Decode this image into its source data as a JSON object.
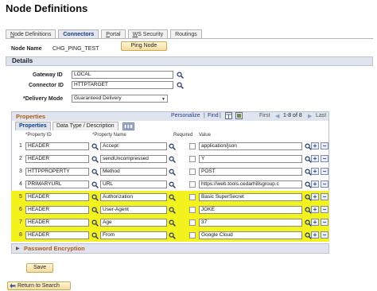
{
  "page": {
    "title": "Node Definitions"
  },
  "tabs": [
    {
      "label": "Node Definitions",
      "key": "N"
    },
    {
      "label": "Connectors",
      "key": "C"
    },
    {
      "label": "Portal",
      "key": "P"
    },
    {
      "label": "WS Security",
      "key": "W"
    },
    {
      "label": "Routings",
      "key": "R"
    }
  ],
  "node": {
    "label": "Node Name",
    "value": "CHG_PING_TEST",
    "ping_button": "Ping Node"
  },
  "details": {
    "title": "Details",
    "gateway": {
      "label": "Gateway ID",
      "value": "LOCAL"
    },
    "connector": {
      "label": "Connector ID",
      "value": "HTTPTARGET"
    },
    "delivery": {
      "label": "*Delivery Mode",
      "value": "Guaranteed Delivery"
    }
  },
  "properties": {
    "title": "Properties",
    "personalize": "Personalize",
    "find": "Find",
    "first": "First",
    "range": "1-8 of 8",
    "last": "Last",
    "subtabs": [
      "Properties",
      "Data Type / Description"
    ],
    "columns": {
      "id": "*Property ID",
      "name": "*Property Name",
      "required": "Required",
      "value": "Value"
    },
    "rows": [
      {
        "num": "1",
        "id": "HEADER",
        "name": "Accept",
        "value": "application/json",
        "highlight": false
      },
      {
        "num": "2",
        "id": "HEADER",
        "name": "sendUncompressed",
        "value": "Y",
        "highlight": false
      },
      {
        "num": "3",
        "id": "HTTPPROPERTY",
        "name": "Method",
        "value": "POST",
        "highlight": false
      },
      {
        "num": "4",
        "id": "PRIMARYURL",
        "name": "URL",
        "value": "https://web.tools.cedarhillsgroup.c",
        "highlight": false
      },
      {
        "num": "5",
        "id": "HEADER",
        "name": "Authorization",
        "value": "Basic SuperSecret",
        "highlight": true
      },
      {
        "num": "6",
        "id": "HEADER",
        "name": "User-Agent",
        "value": "JOKE",
        "highlight": true
      },
      {
        "num": "7",
        "id": "HEADER",
        "name": "Age",
        "value": "37",
        "highlight": true
      },
      {
        "num": "8",
        "id": "HEADER",
        "name": "From",
        "value": "Google Cloud",
        "highlight": true
      }
    ]
  },
  "password_section": {
    "label": "Password Encryption"
  },
  "buttons": {
    "save": "Save",
    "return": "Return to Search"
  },
  "colors": {
    "highlight": "#f4f21c",
    "section_bg": "#dfe4ee",
    "grid_title": "#b45a11",
    "link": "#1f3f8f"
  }
}
